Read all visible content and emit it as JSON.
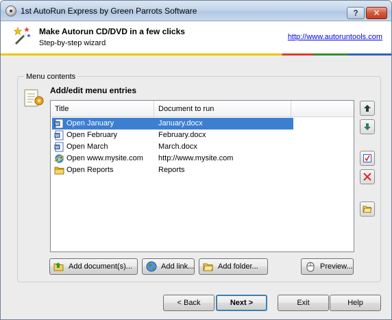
{
  "window": {
    "title": "1st AutoRun Express by Green Parrots Software",
    "help_label": "?",
    "close_label": "✕"
  },
  "banner": {
    "title": "Make Autorun CD/DVD in a few clicks",
    "subtitle": "Step-by-step wizard",
    "link": "http://www.autoruntools.com"
  },
  "group": {
    "label": "Menu contents",
    "section_title": "Add/edit menu entries"
  },
  "list": {
    "columns": [
      "Title",
      "Document to run"
    ],
    "rows": [
      {
        "title": "Open January",
        "doc": "January.docx",
        "icon": "word-doc-icon",
        "selected": true
      },
      {
        "title": "Open February",
        "doc": "February.docx",
        "icon": "word-doc-icon",
        "selected": false
      },
      {
        "title": "Open March",
        "doc": "March.docx",
        "icon": "word-doc-icon",
        "selected": false
      },
      {
        "title": "Open www.mysite.com",
        "doc": "http://www.mysite.com",
        "icon": "internet-explorer-icon",
        "selected": false
      },
      {
        "title": "Open Reports",
        "doc": "Reports",
        "icon": "folder-icon",
        "selected": false
      }
    ]
  },
  "side_buttons": [
    "move-up-icon",
    "move-down-icon",
    "edit-entry-icon",
    "delete-entry-icon",
    "open-folder-icon"
  ],
  "actions": {
    "add_documents": "Add document(s)...",
    "add_link": "Add link...",
    "add_folder": "Add folder...",
    "preview": "Preview..."
  },
  "nav": {
    "back": "< Back",
    "next": "Next >",
    "exit": "Exit",
    "help": "Help"
  },
  "colors": {
    "selection": "#3c7fd1",
    "link": "#0000ee",
    "strip": [
      "#f2c400",
      "#e23b2a",
      "#2f8f2f",
      "#2f5fc4"
    ]
  }
}
